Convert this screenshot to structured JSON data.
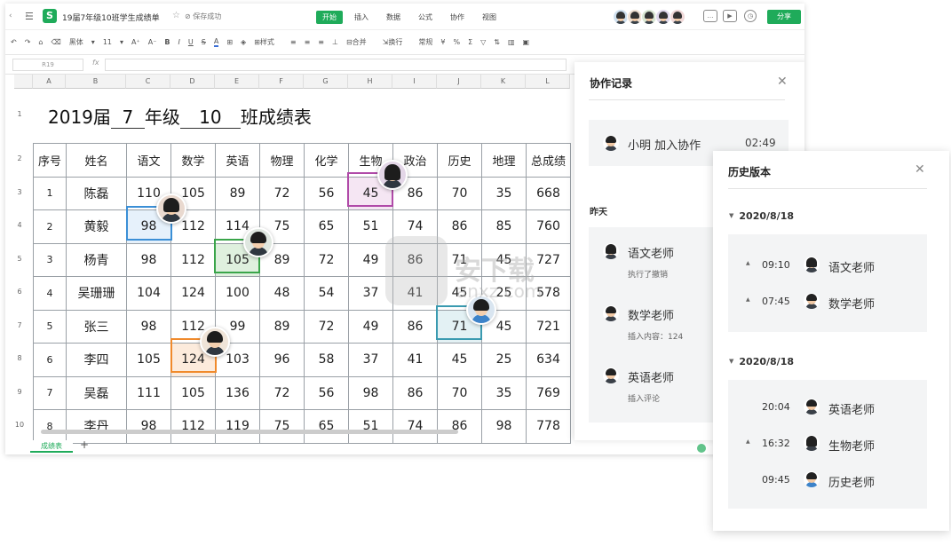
{
  "titlebar": {
    "doc_title": "19届7年级10班学生成绩单",
    "saved": "保存成功",
    "logo": "S",
    "share": "分享"
  },
  "menu_tabs": [
    "开始",
    "插入",
    "数据",
    "公式",
    "协作",
    "视图"
  ],
  "toolbar": {
    "font": "黑体",
    "size": "11",
    "merge": "合并",
    "wrap": "换行",
    "style": "样式",
    "format": "常规"
  },
  "namebox": "R19",
  "fx": "fx",
  "columns": [
    "A",
    "B",
    "C",
    "D",
    "E",
    "F",
    "G",
    "H",
    "I",
    "J",
    "K",
    "L"
  ],
  "rows": [
    "1",
    "2",
    "3",
    "4",
    "5",
    "6",
    "7",
    "8",
    "9",
    "10"
  ],
  "sheet_title": {
    "pre": "2019届",
    "grade": "7",
    "mid": "年级",
    "cls": "10",
    "post": "班成绩表"
  },
  "table": {
    "header": [
      "序号",
      "姓名",
      "语文",
      "数学",
      "英语",
      "物理",
      "化学",
      "生物",
      "政治",
      "历史",
      "地理",
      "总成绩"
    ],
    "rows": [
      [
        "1",
        "陈磊",
        "110",
        "105",
        "89",
        "72",
        "56",
        "45",
        "86",
        "70",
        "35",
        "668"
      ],
      [
        "2",
        "黄毅",
        "98",
        "112",
        "114",
        "75",
        "65",
        "51",
        "74",
        "86",
        "85",
        "760"
      ],
      [
        "3",
        "杨青",
        "98",
        "112",
        "105",
        "89",
        "72",
        "49",
        "86",
        "71",
        "45",
        "727"
      ],
      [
        "4",
        "吴珊珊",
        "104",
        "124",
        "100",
        "48",
        "54",
        "37",
        "41",
        "45",
        "25",
        "578"
      ],
      [
        "5",
        "张三",
        "98",
        "112",
        "99",
        "89",
        "72",
        "49",
        "86",
        "71",
        "45",
        "721"
      ],
      [
        "6",
        "李四",
        "105",
        "124",
        "103",
        "96",
        "58",
        "37",
        "41",
        "45",
        "25",
        "634"
      ],
      [
        "7",
        "吴磊",
        "111",
        "105",
        "136",
        "72",
        "56",
        "98",
        "86",
        "70",
        "35",
        "769"
      ],
      [
        "8",
        "李丹",
        "98",
        "112",
        "119",
        "75",
        "65",
        "51",
        "74",
        "86",
        "98",
        "778"
      ]
    ]
  },
  "sheet_tab": "成绩表",
  "add_tab": "+",
  "collab_panel": {
    "title": "协作记录",
    "current": {
      "name": "小明 加入协作",
      "time": "02:49"
    },
    "section": "昨天",
    "items": [
      {
        "name": "语文老师",
        "action": "执行了撤销"
      },
      {
        "name": "数学老师",
        "action": "插入内容：124"
      },
      {
        "name": "英语老师",
        "action": "插入评论"
      }
    ]
  },
  "history_panel": {
    "title": "历史版本",
    "groups": [
      {
        "date": "2020/8/18",
        "items": [
          {
            "time": "09:10",
            "name": "语文老师"
          },
          {
            "time": "07:45",
            "name": "数学老师"
          }
        ]
      },
      {
        "date": "2020/8/18",
        "items": [
          {
            "time": "20:04",
            "name": "英语老师"
          },
          {
            "time": "16:32",
            "name": "生物老师"
          },
          {
            "time": "09:45",
            "name": "历史老师"
          }
        ]
      }
    ]
  },
  "watermark": {
    "text": "安下载",
    "sub": "anxz.com"
  },
  "colors": {
    "accent": "#1fab5a",
    "sel_blue": "#3b8fd6",
    "sel_green": "#3aa54a",
    "sel_purple": "#b04aa8",
    "sel_orange": "#f08a2c",
    "sel_teal": "#3a9ab0"
  }
}
